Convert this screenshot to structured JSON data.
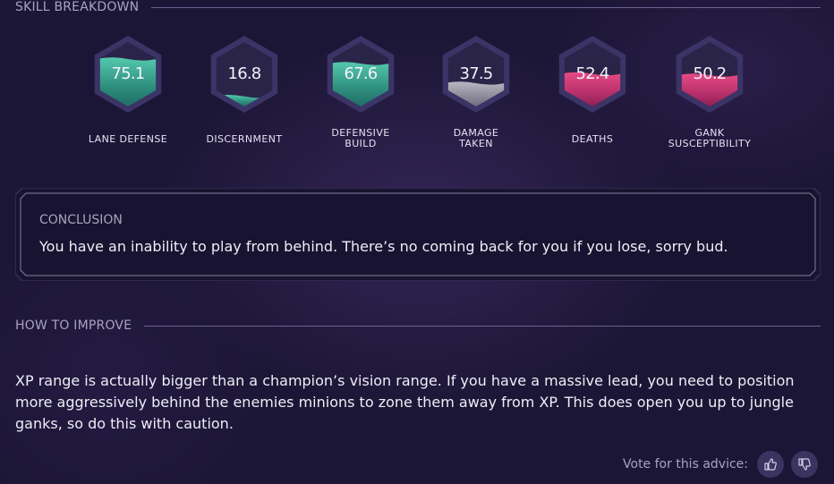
{
  "skill_breakdown": {
    "title": "SKILL BREAKDOWN",
    "stats": [
      {
        "label": "LANE DEFENSE",
        "value": "75.1",
        "level": 0.75,
        "color": "teal"
      },
      {
        "label": "DISCERNMENT",
        "value": "16.8",
        "level": 0.17,
        "color": "teal"
      },
      {
        "label_lines": [
          "DEFENSIVE",
          "BUILD"
        ],
        "value": "67.6",
        "level": 0.68,
        "color": "teal"
      },
      {
        "label_lines": [
          "DAMAGE",
          "TAKEN"
        ],
        "value": "37.5",
        "level": 0.375,
        "color": "gray"
      },
      {
        "label": "DEATHS",
        "value": "52.4",
        "level": 0.52,
        "color": "pink"
      },
      {
        "label_lines": [
          "GANK",
          "SUSCEPTIBILITY"
        ],
        "value": "50.2",
        "level": 0.5,
        "color": "pink"
      }
    ]
  },
  "conclusion": {
    "title": "CONCLUSION",
    "text": "You have an inability to play from behind. There’s no coming back for you if you lose, sorry bud."
  },
  "how_to_improve": {
    "title": "HOW TO IMPROVE",
    "text": "XP range is actually bigger than a champion’s vision range. If you have a massive lead, you need to position more aggressively behind the enemies minions to zone them away from XP. This does open you up to jungle ganks, so do this with caution."
  },
  "vote": {
    "label": "Vote for this advice:",
    "up_icon": "thumbs-up-icon",
    "down_icon": "thumbs-down-icon"
  },
  "colors": {
    "background": "#1c1636",
    "teal": "#3fb39a",
    "pink": "#d13a7a",
    "gray": "#9a98a6",
    "hex_border": "#3b3466",
    "hex_inner": "#2a2448"
  }
}
